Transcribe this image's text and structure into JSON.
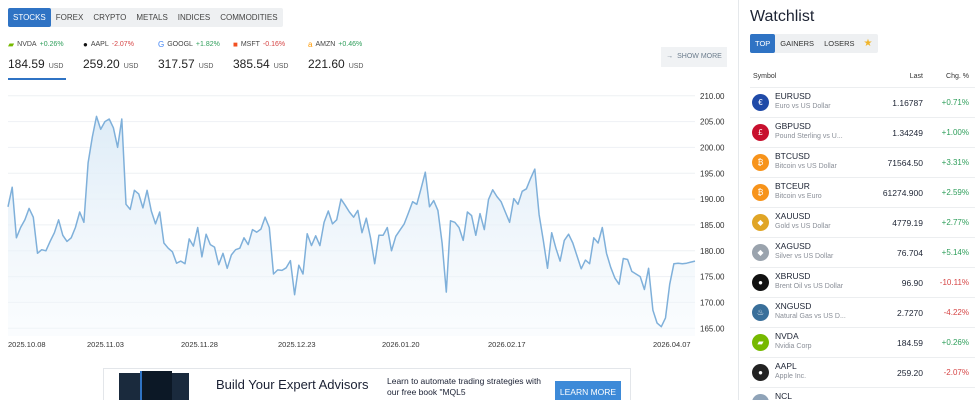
{
  "market_tabs": [
    "STOCKS",
    "FOREX",
    "CRYPTO",
    "METALS",
    "INDICES",
    "COMMODITIES"
  ],
  "tickers": [
    {
      "symbol": "NVDA",
      "change": "+0.26%",
      "price": "184.59",
      "currency": "USD",
      "icon": "nvidia-logo",
      "icon_glyph": "▰",
      "icon_color": "#76b900",
      "direction": "up"
    },
    {
      "symbol": "AAPL",
      "change": "-2.07%",
      "price": "259.20",
      "currency": "USD",
      "icon": "apple-logo",
      "icon_glyph": "●",
      "icon_color": "#111111",
      "direction": "down"
    },
    {
      "symbol": "GOOGL",
      "change": "+1.82%",
      "price": "317.57",
      "currency": "USD",
      "icon": "google-logo",
      "icon_glyph": "G",
      "icon_color": "#4285f4",
      "direction": "up"
    },
    {
      "symbol": "MSFT",
      "change": "-0.16%",
      "price": "385.54",
      "currency": "USD",
      "icon": "microsoft-logo",
      "icon_glyph": "■",
      "icon_color": "#f25022",
      "direction": "down"
    },
    {
      "symbol": "AMZN",
      "change": "+0.46%",
      "price": "221.60",
      "currency": "USD",
      "icon": "amazon-logo",
      "icon_glyph": "a",
      "icon_color": "#ff9900",
      "direction": "up"
    }
  ],
  "show_more": "SHOW MORE",
  "chart_data": {
    "type": "area",
    "x_tick_labels": [
      "2025.10.08",
      "2025.11.03",
      "2025.11.28",
      "2025.12.23",
      "2026.01.20",
      "2026.02.17",
      "2026.04.07"
    ],
    "y_tick_labels": [
      "210.00",
      "205.00",
      "200.00",
      "195.00",
      "190.00",
      "185.00",
      "180.00",
      "175.00",
      "170.00",
      "165.00"
    ],
    "ylim": [
      163.5,
      211.5
    ],
    "series": [
      {
        "values": [
          188.5,
          192.3,
          182.5,
          184.5,
          186,
          188.2,
          186.5,
          179.5,
          180.2,
          180,
          181.8,
          183.5,
          186,
          183,
          181.8,
          182.5,
          184.5,
          187.5,
          185.5,
          197,
          202,
          206,
          203.5,
          205,
          205.5,
          203.8,
          200,
          205.5,
          189,
          188,
          191.7,
          191,
          188.3,
          191.7,
          187.7,
          185.2,
          187.5,
          181.5,
          180.5,
          179.8,
          177.6,
          178,
          177.5,
          182.3,
          180.9,
          184.5,
          178.8,
          183.2,
          181.2,
          180.7,
          177.3,
          179.5,
          176.6,
          179.2,
          180.2,
          180.5,
          182.5,
          181.2,
          184.1,
          183.6,
          184.2,
          186.5,
          184.5,
          175.5,
          176.3,
          176.2,
          176.7,
          178.1,
          171.5,
          177.2,
          175.5,
          183.3,
          181,
          182.9,
          181,
          185.5,
          187.7,
          185.2,
          186,
          190,
          188.8,
          187.5,
          186.5,
          187.8,
          183.5,
          186.3,
          182.5,
          177.5,
          183,
          183,
          184.5,
          180,
          182.8,
          184,
          185.2,
          187.3,
          189.5,
          189,
          192,
          195.2,
          188.5,
          189.7,
          187.8,
          181.5,
          172,
          185.8,
          185.5,
          184.5,
          182,
          187.5,
          186.8,
          183,
          187.2,
          184.1,
          189.9,
          191.8,
          190.5,
          189.5,
          187.5,
          185.5,
          190.1,
          189,
          191.5,
          192,
          194,
          195.8,
          187,
          182,
          176.6,
          183.5,
          180.5,
          178,
          182,
          183.2,
          181.5,
          179,
          176.5,
          178.2,
          177.5,
          182.5,
          181.5,
          184.5,
          179.5,
          176.8,
          174.7,
          173.5,
          178.5,
          178.3,
          176,
          175.5,
          175,
          172.5,
          176.6,
          168.5,
          166,
          165.3,
          167,
          173.5,
          177.5,
          177.6,
          177.5,
          177.6,
          177.8,
          178
        ]
      }
    ]
  },
  "ad": {
    "title": "Build Your Expert Advisors",
    "description": "Learn to automate trading strategies with our free book \"MQL5",
    "button": "LEARN MORE"
  },
  "watchlist": {
    "title": "Watchlist",
    "tabs": [
      "TOP",
      "GAINERS",
      "LOSERS"
    ],
    "star_icon": "star-icon",
    "headers": {
      "symbol": "Symbol",
      "last": "Last",
      "change": "Chg. %"
    },
    "items": [
      {
        "symbol": "EURUSD",
        "name": "Euro vs US Dollar",
        "last": "1.16787",
        "change": "+0.71%",
        "direction": "up",
        "icon": "eu-us-flag-icon",
        "icon_glyph": "€",
        "icon_color": "#1f4aa8"
      },
      {
        "symbol": "GBPUSD",
        "name": "Pound Sterling vs U...",
        "last": "1.34249",
        "change": "+1.00%",
        "direction": "up",
        "icon": "gb-us-flag-icon",
        "icon_glyph": "£",
        "icon_color": "#c8102e"
      },
      {
        "symbol": "BTCUSD",
        "name": "Bitcoin vs US Dollar",
        "last": "71564.50",
        "change": "+3.31%",
        "direction": "up",
        "icon": "bitcoin-icon",
        "icon_glyph": "₿",
        "icon_color": "#f7931a"
      },
      {
        "symbol": "BTCEUR",
        "name": "Bitcoin vs Euro",
        "last": "61274.900",
        "change": "+2.59%",
        "direction": "up",
        "icon": "bitcoin-icon",
        "icon_glyph": "₿",
        "icon_color": "#f7931a"
      },
      {
        "symbol": "XAUUSD",
        "name": "Gold vs US Dollar",
        "last": "4779.19",
        "change": "+2.77%",
        "direction": "up",
        "icon": "gold-icon",
        "icon_glyph": "◆",
        "icon_color": "#e0a526"
      },
      {
        "symbol": "XAGUSD",
        "name": "Silver vs US Dollar",
        "last": "76.704",
        "change": "+5.14%",
        "direction": "up",
        "icon": "silver-icon",
        "icon_glyph": "◆",
        "icon_color": "#9aa3ad"
      },
      {
        "symbol": "XBRUSD",
        "name": "Brent Oil vs US Dollar",
        "last": "96.90",
        "change": "-10.11%",
        "direction": "down",
        "icon": "oil-drop-icon",
        "icon_glyph": "●",
        "icon_color": "#111111"
      },
      {
        "symbol": "XNGUSD",
        "name": "Natural Gas vs US D...",
        "last": "2.7270",
        "change": "-4.22%",
        "direction": "down",
        "icon": "gas-flame-icon",
        "icon_glyph": "♨",
        "icon_color": "#3a6f9a"
      },
      {
        "symbol": "NVDA",
        "name": "Nvidia Corp",
        "last": "184.59",
        "change": "+0.26%",
        "direction": "up",
        "icon": "nvidia-logo",
        "icon_glyph": "▰",
        "icon_color": "#76b900"
      },
      {
        "symbol": "AAPL",
        "name": "Apple Inc.",
        "last": "259.20",
        "change": "-2.07%",
        "direction": "down",
        "icon": "apple-logo",
        "icon_glyph": "●",
        "icon_color": "#222222"
      },
      {
        "symbol": "NCL",
        "name": "",
        "last": "",
        "change": "",
        "direction": "up",
        "icon": "generic-icon",
        "icon_glyph": "",
        "icon_color": "#8fa3b8"
      }
    ]
  },
  "colors": {
    "accent": "#2f73c4",
    "up": "#2e9e5a",
    "down": "#d64545",
    "line": "#7fb0da"
  }
}
